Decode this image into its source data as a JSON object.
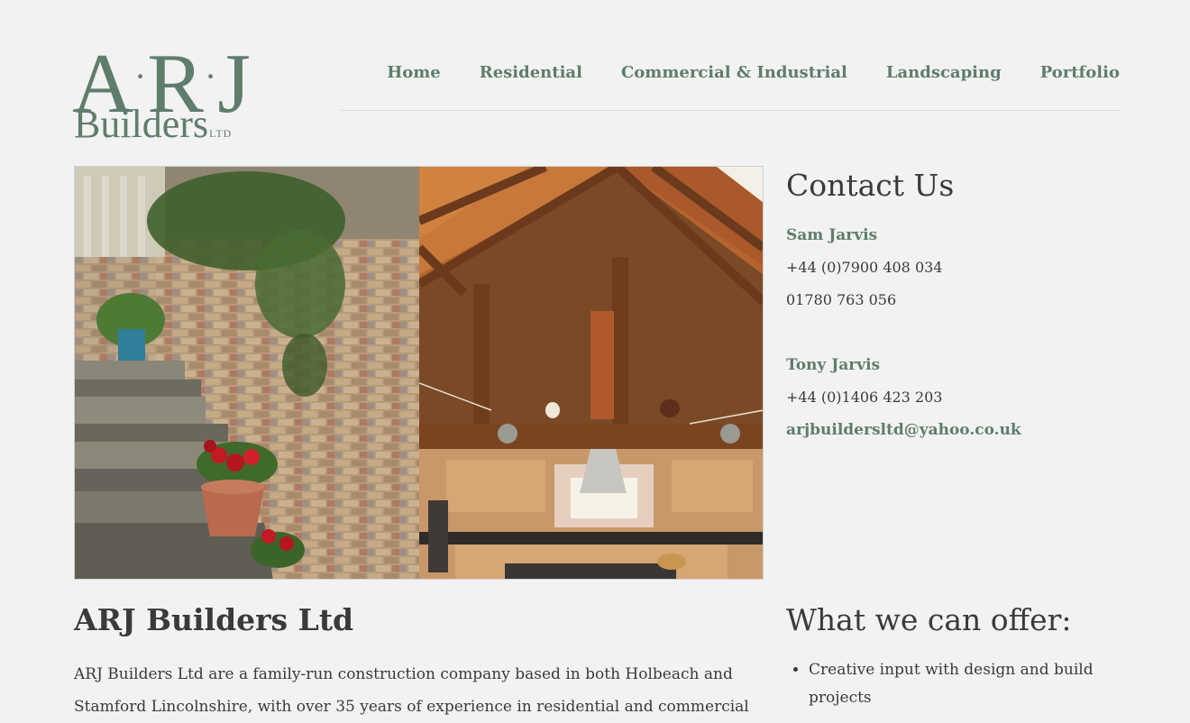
{
  "logo": {
    "mark": "ARJ",
    "letters": [
      "A",
      "R",
      "J"
    ],
    "wordmark": "Builders",
    "suffix": "LTD",
    "color": "#5f7d6b"
  },
  "nav": {
    "items": [
      "Home",
      "Residential",
      "Commercial & Industrial",
      "Landscaping",
      "Portfolio"
    ]
  },
  "hero": {
    "left_image": "garden-steps-photo",
    "right_image": "timber-kitchen-photo"
  },
  "contact": {
    "title": "Contact Us",
    "people": [
      {
        "name": "Sam Jarvis",
        "phones": [
          "+44 (0)7900 408 034",
          "01780 763 056"
        ]
      },
      {
        "name": "Tony Jarvis",
        "phones": [
          "+44 (0)1406 423 203"
        ]
      }
    ],
    "email": "arjbuildersltd@yahoo.co.uk"
  },
  "intro": {
    "title": "ARJ Builders Ltd",
    "body": "ARJ Builders Ltd are a family-run construction company based in both Holbeach and Stamford Lincolnshire, with over 35 years of experience in residential and commercial"
  },
  "offer": {
    "title": "What we can offer:",
    "items": [
      "Creative input with design and build projects"
    ]
  },
  "colors": {
    "accent": "#5f7d6b",
    "text": "#3a3a3a",
    "background": "#f2f2f2"
  }
}
